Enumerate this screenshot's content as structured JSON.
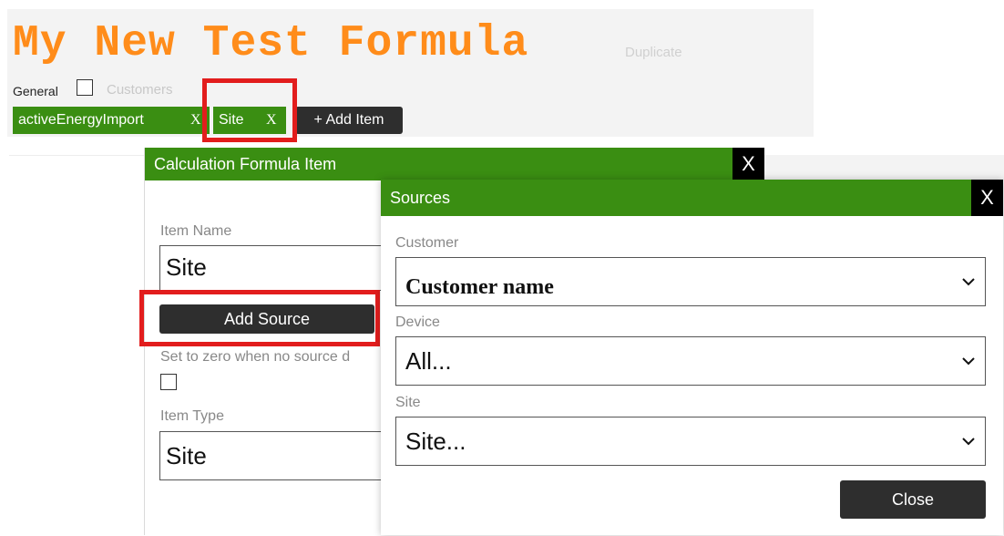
{
  "header": {
    "title": "My New Test Formula",
    "duplicate_label": "Duplicate",
    "tabs": {
      "general": "General",
      "customers": "Customers"
    }
  },
  "items": [
    {
      "label": "activeEnergyImport",
      "remove": "X"
    },
    {
      "label": "Site",
      "remove": "X"
    }
  ],
  "add_item_label": "+ Add Item",
  "formula_item_dialog": {
    "title": "Calculation Formula Item",
    "close": "X",
    "item_name_label": "Item Name",
    "item_name_value": "Site",
    "add_source_label": "Add Source",
    "zero_label": "Set to zero when no source d",
    "item_type_label": "Item Type",
    "item_type_value": "Site"
  },
  "sources_dialog": {
    "title": "Sources",
    "close": "X",
    "customer_label": "Customer",
    "customer_value": "Customer name",
    "device_label": "Device",
    "device_value": "All...",
    "site_label": "Site",
    "site_value": "Site...",
    "close_button": "Close"
  },
  "colors": {
    "accent_green": "#3a8e12",
    "title_orange": "#ff8c1a",
    "highlight_red": "#e21d1d"
  },
  "icons": {
    "chevron": "chevron-down-icon"
  }
}
